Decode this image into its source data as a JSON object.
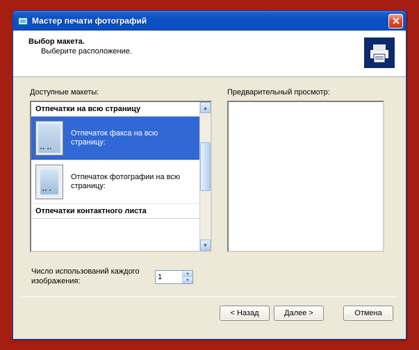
{
  "window": {
    "title": "Мастер печати фотографий"
  },
  "header": {
    "title": "Выбор макета.",
    "subtitle": "Выберите расположение."
  },
  "labels": {
    "available": "Доступные макеты:",
    "preview": "Предварительный просмотр:",
    "uses": "Число использований каждого изображения:"
  },
  "layouts": {
    "group1": "Отпечатки на всю страницу",
    "items": [
      {
        "label": "Отпечаток факса на всю страницу:",
        "selected": true
      },
      {
        "label": "Отпечаток фотографии на всю страницу:",
        "selected": false
      }
    ],
    "group2": "Отпечатки контактного листа"
  },
  "uses_value": "1",
  "buttons": {
    "back": "< Назад",
    "next": "Далее >",
    "cancel": "Отмена"
  }
}
